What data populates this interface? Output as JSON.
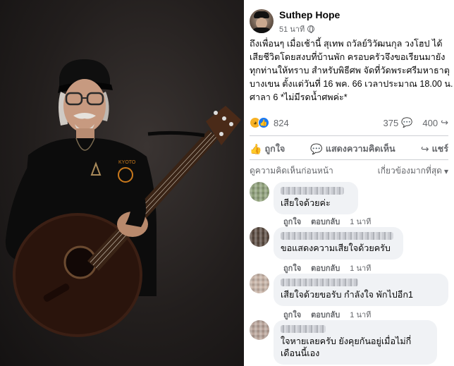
{
  "photo": {
    "guitar_text": "KYOTO"
  },
  "post": {
    "author": "Suthep Hope",
    "time": "51 นาที",
    "text_lines": [
      "ถึงเพื่อนๆ เมื่อเช้านี้ สุเทพ ถวัลย์วิวัฒนกุล วงโฮป ได้",
      "เสียชีวิตโดยสงบที่บ้านพัก ครอบครัวจึงขอเรียนมายัง",
      "ทุกท่านให้ทราบ สำหรับพิธีศพ จัดที่วัดพระศรีมหาธาตุ",
      "บางเขน ตั้งแต่วันที่ 16 พค. 66 เวลาประมาณ 18.00 น.",
      "ศาลา 6 *ไม่มีรดน้ำศพค่ะ*"
    ],
    "reaction_count": "824",
    "comment_count": "375",
    "share_count": "400",
    "actions": {
      "like": "ถูกใจ",
      "comment": "แสดงความคิดเห็น",
      "share": "แชร์"
    },
    "sort_left": "ดูความคิดเห็นก่อนหน้า",
    "sort_right": "เกี่ยวข้องมากที่สุด"
  },
  "comments": [
    {
      "text_lines": [
        "เสียใจด้วยค่ะ"
      ],
      "like": "ถูกใจ",
      "reply": "ตอบกลับ",
      "time": "1 นาที"
    },
    {
      "text_lines": [
        "ขอแสดงความเสียใจด้วยครับ"
      ],
      "like": "ถูกใจ",
      "reply": "ตอบกลับ",
      "time": "1 นาที"
    },
    {
      "text_lines": [
        "เสียใจด้วยขอรับ กำลังใจ พักไปอีก1"
      ],
      "like": "ถูกใจ",
      "reply": "ตอบกลับ",
      "time": "1 นาที"
    },
    {
      "text_lines": [
        "ใจหายเลยครับ ยังคุยกันอยู่เมื่อไม่กี่",
        "เดือนนี้เอง"
      ]
    }
  ],
  "icons": {
    "globe": "globe-icon",
    "comment_stat": "💬",
    "share_stat": "↪",
    "like_action": "👍",
    "comment_action": "💬",
    "share_action": "↪",
    "sort_chevron": "▾"
  },
  "colors": {
    "facebook_blue": "#1877f2",
    "muted_text": "#65676b",
    "bubble_bg": "#f0f2f5"
  }
}
